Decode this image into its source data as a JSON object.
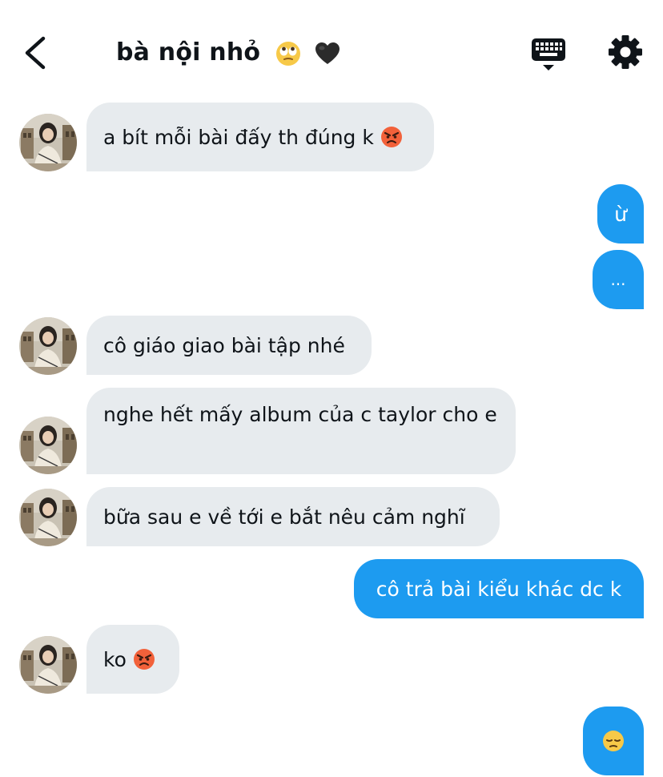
{
  "header": {
    "title": "bà nội nhỏ",
    "title_emojis": [
      "face-with-rolling-eyes",
      "black-heart"
    ],
    "icons": [
      "chevron-left-icon",
      "keyboard-icon",
      "gear-icon"
    ]
  },
  "colors": {
    "incoming_bubble": "#e7ebee",
    "outgoing_bubble": "#1d9bf0",
    "text": "#0f1419"
  },
  "messages": [
    {
      "side": "in",
      "text": "a bít mỗi bài đấy th đúng k",
      "emoji": "angry-face"
    },
    {
      "side": "out",
      "text": "ừ"
    },
    {
      "side": "out",
      "text": "..."
    },
    {
      "side": "in",
      "text": "cô giáo giao bài tập nhé"
    },
    {
      "side": "in",
      "text": "nghe hết mấy album của c taylor cho e"
    },
    {
      "side": "in",
      "text": "bữa sau e về tới e bắt nêu cảm nghĩ"
    },
    {
      "side": "out",
      "text": "cô trả bài kiểu khác dc k"
    },
    {
      "side": "in",
      "text": "ko",
      "emoji": "angry-face"
    },
    {
      "side": "out",
      "text": "",
      "emoji": "pensive-face"
    }
  ]
}
